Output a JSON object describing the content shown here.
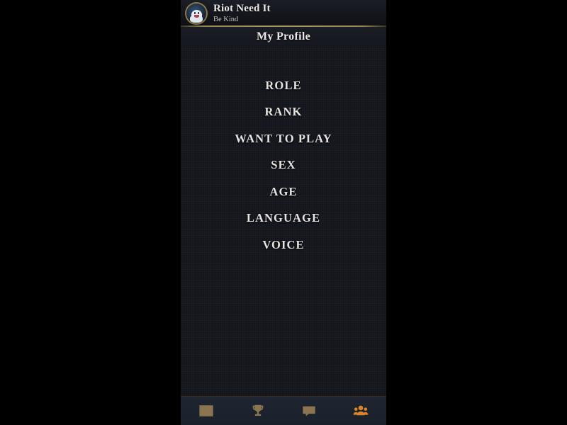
{
  "account": {
    "name": "Riot Need It",
    "status": "Be Kind",
    "avatar_icon": "user-avatar-portrait"
  },
  "header": {
    "title": "My Profile"
  },
  "profile_menu": {
    "items": [
      {
        "label": "ROLE"
      },
      {
        "label": "RANK"
      },
      {
        "label": "WANT TO PLAY"
      },
      {
        "label": "SEX"
      },
      {
        "label": "AGE"
      },
      {
        "label": "LANGUAGE"
      },
      {
        "label": "VOICE"
      }
    ]
  },
  "bottom_nav": {
    "items": [
      {
        "icon": "news-feed-icon",
        "active": false
      },
      {
        "icon": "trophy-icon",
        "active": false
      },
      {
        "icon": "chat-bubble-icon",
        "active": false
      },
      {
        "icon": "friends-people-icon",
        "active": true
      }
    ]
  },
  "colors": {
    "panel_bg": "#13151c",
    "header_bg": "#1b1e26",
    "divider_gold": "#a79767",
    "nav_bg": "#1e2530",
    "icon_inactive": "#8a7550",
    "icon_active": "#d9862a",
    "text_primary": "#e9e9e6",
    "stage_bg": "#000000"
  }
}
